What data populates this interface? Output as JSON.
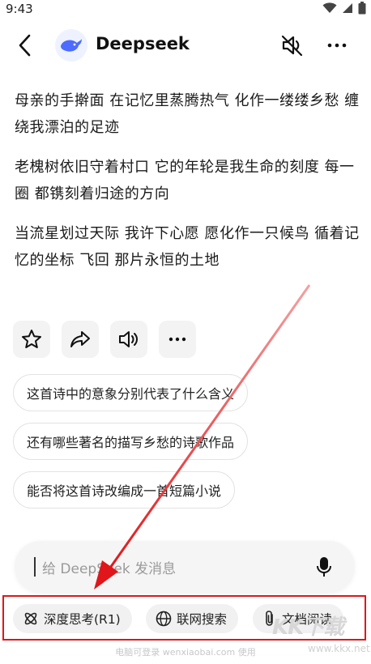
{
  "status_bar": {
    "time": "9:43"
  },
  "header": {
    "title": "Deepseek",
    "back_icon": "back-arrow-icon",
    "mute_icon": "speaker-muted-icon",
    "more_icon": "more-dots-icon"
  },
  "poem": {
    "paragraphs": [
      "母亲的手擀面 在记忆里蒸腾热气 化作一缕缕乡愁 缠绕我漂泊的足迹",
      "老槐树依旧守着村口 它的年轮是我生命的刻度 每一圈 都镌刻着归途的方向",
      "当流星划过天际 我许下心愿 愿化作一只候鸟 循着记忆的坐标 飞回 那片永恒的土地"
    ]
  },
  "actions": [
    "star-icon",
    "share-icon",
    "speaker-icon",
    "more-dots-icon"
  ],
  "suggestions": [
    "这首诗中的意象分别代表了什么含义",
    "还有哪些著名的描写乡愁的诗歌作品",
    "能否将这首诗改编成一首短篇小说"
  ],
  "input": {
    "placeholder": "给 DeepSeek 发消息"
  },
  "modes": [
    {
      "label": "深度思考(R1)",
      "icon": "atom-icon"
    },
    {
      "label": "联网搜索",
      "icon": "globe-icon"
    },
    {
      "label": "文档阅读",
      "icon": "paperclip-icon"
    }
  ],
  "footer_note": "电脑可登录 wenxiaobai.com 使用",
  "watermark": {
    "brand": "KK下载",
    "url": "www.kkx.net"
  },
  "colors": {
    "highlight": "#e0161a",
    "accent": "#4d6bfe"
  }
}
